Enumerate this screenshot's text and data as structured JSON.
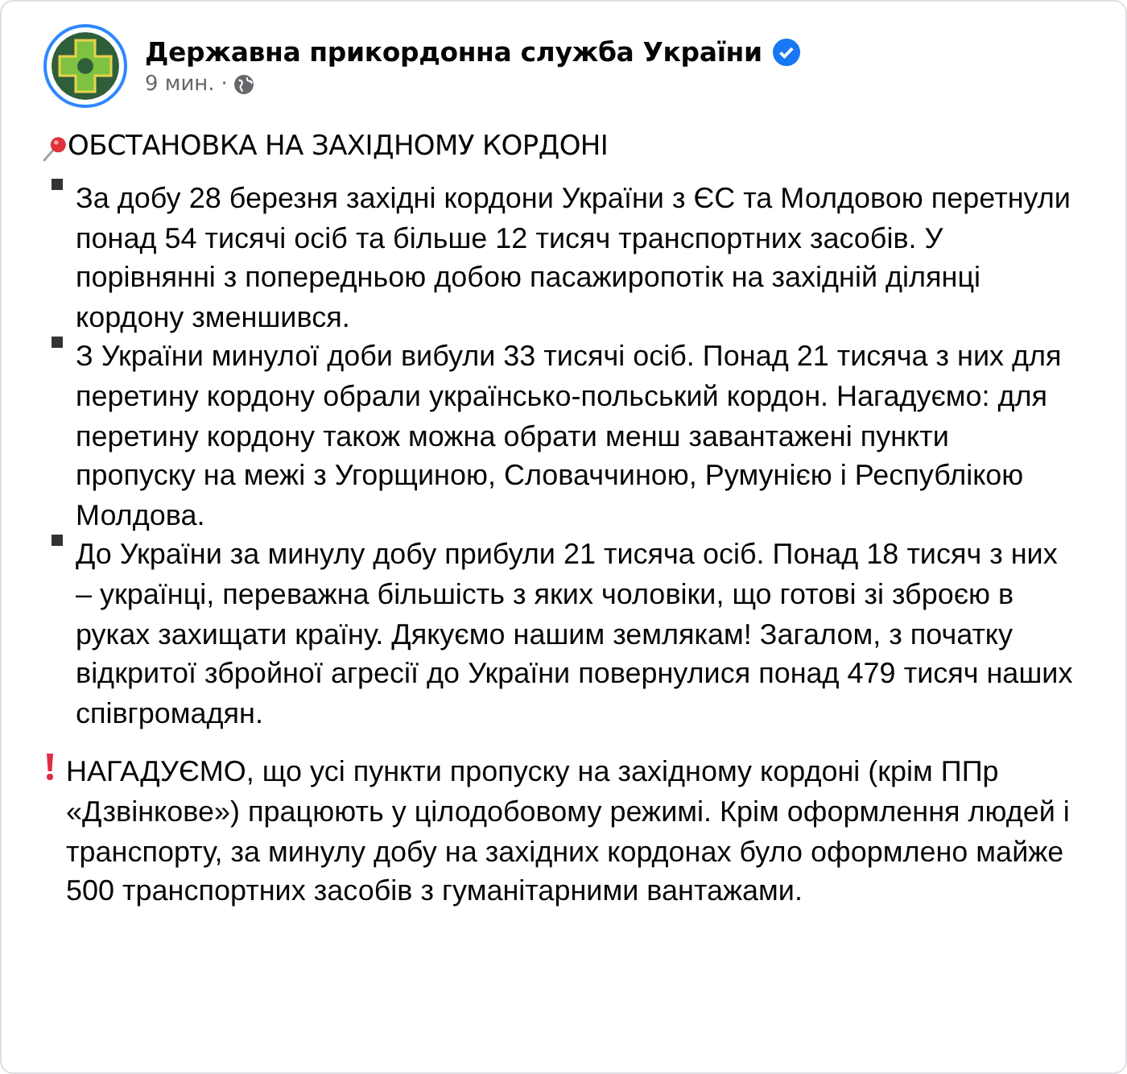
{
  "post": {
    "author": "Державна прикордонна служба України",
    "verified": true,
    "time": "9 мин.",
    "separator": "·",
    "heading": "ОБСТАНОВКА НА ЗАХІДНОМУ КОРДОНІ",
    "paragraphs": [
      {
        "kind": "bullet",
        "text": "За добу 28 березня західні кордони України з ЄС та Молдовою перетнули понад 54 тисячі осіб та більше 12 тисяч транспортних засобів. У порівнянні з попередньою добою пасажиропотік на західній ділянці кордону зменшився."
      },
      {
        "kind": "bullet",
        "text": "З України минулої доби вибули 33 тисячі осіб. Понад 21 тисяча з них для перетину кордону обрали українсько-польський кордон. Нагадуємо: для перетину кордону також можна обрати менш завантажені пункти пропуску на межі з Угорщиною, Словаччиною, Румунією і Республікою Молдова."
      },
      {
        "kind": "bullet",
        "text": "До України за минулу добу прибули 21 тисяча осіб. Понад 18 тисяч з них – українці, переважна більшість з яких чоловіки, що готові зі зброєю в руках захищати країну. Дякуємо нашим землякам! Загалом, з початку відкритої збройної агресії до України повернулися понад 479 тисяч наших співгромадян."
      },
      {
        "kind": "alert",
        "text": "НАГАДУЄМО, що усі пункти пропуску на західному кордоні (крім ППр «Дзвінкове») працюють у цілодобовому режимі. Крім оформлення людей і транспорту, за минулу добу на західних кордонах було оформлено майже 500 транспортних засобів з гуманітарними вантажами."
      }
    ]
  }
}
